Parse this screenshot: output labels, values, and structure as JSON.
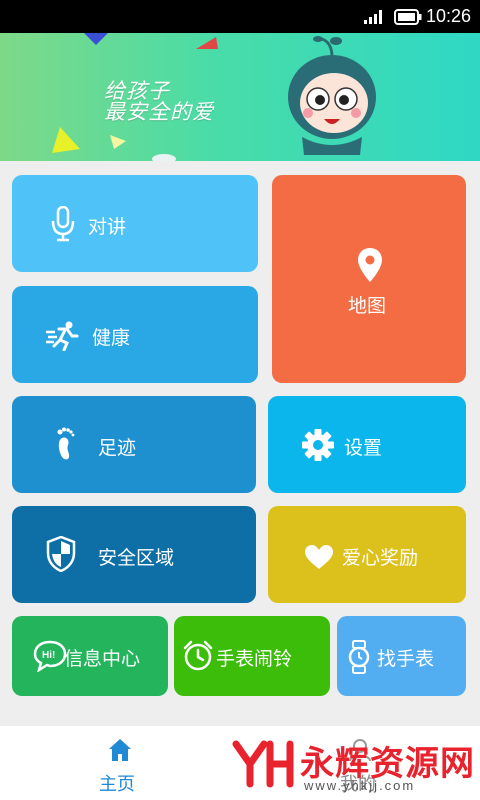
{
  "status_bar": {
    "time": "10:26"
  },
  "banner": {
    "slogan_line1": "给孩子",
    "slogan_line2": "最安全的爱",
    "pager": [
      "1",
      "2",
      "3"
    ],
    "active_page": "3"
  },
  "tiles": {
    "intercom": {
      "label": "对讲",
      "color": "#4fc3f7",
      "icon": "microphone-icon"
    },
    "map": {
      "label": "地图",
      "color": "#f36c44",
      "icon": "map-pin-icon"
    },
    "health": {
      "label": "健康",
      "color": "#2aa8e6",
      "icon": "runner-icon"
    },
    "footprint": {
      "label": "足迹",
      "color": "#1e8fcf",
      "icon": "footprint-icon"
    },
    "settings": {
      "label": "设置",
      "color": "#0bb6ec",
      "icon": "gear-icon"
    },
    "safe_zone": {
      "label": "安全区域",
      "color": "#0e6fa6",
      "icon": "shield-icon"
    },
    "love_reward": {
      "label": "爱心奖励",
      "color": "#dcc01b",
      "icon": "heart-icon"
    },
    "message_center": {
      "label": "信息中心",
      "color": "#24b45c",
      "icon": "chat-bubble-icon"
    },
    "watch_alarm": {
      "label": "手表闹铃",
      "color": "#3bbd0a",
      "icon": "alarm-clock-icon"
    },
    "find_watch": {
      "label": "找手表",
      "color": "#52aef0",
      "icon": "watch-icon"
    }
  },
  "bottom_nav": {
    "home_label": "主页",
    "other_label": "我的"
  },
  "watermark": {
    "title": "永辉资源网",
    "url": "www.yhkjj.com"
  }
}
